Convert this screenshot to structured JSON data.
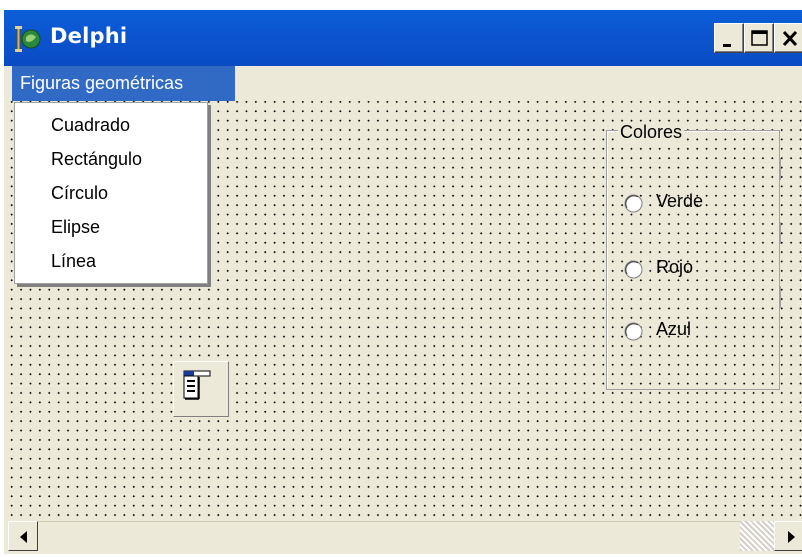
{
  "window": {
    "title": "Delphi",
    "icon": "delphi-app-icon"
  },
  "title_buttons": {
    "minimize": "minimize-icon",
    "maximize": "maximize-icon",
    "close": "close-icon"
  },
  "menu": {
    "title": "Figuras geométricas",
    "items": [
      "Cuadrado",
      "Rectángulo",
      "Círculo",
      "Elipse",
      "Línea"
    ]
  },
  "groupbox": {
    "label": "Colores",
    "options": [
      "Verde",
      "Rojo",
      "Azul"
    ]
  },
  "colors": {
    "title_bar": "#0a5fd8",
    "menu_highlight": "#316ac5",
    "form_background": "#ece9d8"
  }
}
